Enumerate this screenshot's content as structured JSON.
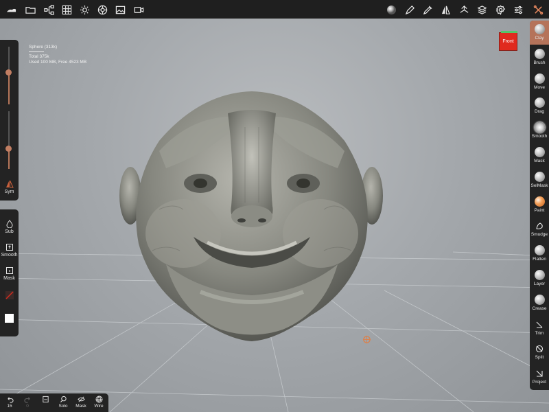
{
  "info": {
    "object": "Sphere (313k)",
    "total": "Total 375k",
    "memory": "Used 100 MB, Free 4523 MB"
  },
  "view_cube": {
    "label": "Front"
  },
  "left_panel": {
    "sym_label": "Sym",
    "tools": [
      {
        "icon": "drop-icon",
        "label": "Sub"
      },
      {
        "icon": "smooth-box-icon",
        "label": "Smooth"
      },
      {
        "icon": "mask-box-icon",
        "label": "Mask"
      }
    ],
    "radius_level": 0.55,
    "intensity_level": 0.35
  },
  "right_tools": [
    {
      "label": "Clay",
      "icon": "clay-ball-icon",
      "active": true
    },
    {
      "label": "Brush",
      "icon": "brush-ball-icon"
    },
    {
      "label": "Move",
      "icon": "move-ball-icon"
    },
    {
      "label": "Drag",
      "icon": "drag-ball-icon"
    },
    {
      "label": "Smooth",
      "icon": "smooth-ball-icon"
    },
    {
      "label": "Mask",
      "icon": "mask-ball-icon"
    },
    {
      "label": "SelMask",
      "icon": "selmask-ball-icon"
    },
    {
      "label": "Paint",
      "icon": "paint-ball-icon"
    },
    {
      "label": "Smudge",
      "icon": "smudge-icon"
    },
    {
      "label": "Flatten",
      "icon": "flatten-ball-icon"
    },
    {
      "label": "Layer",
      "icon": "layer-ball-icon"
    },
    {
      "label": "Crease",
      "icon": "crease-ball-icon"
    },
    {
      "label": "Trim",
      "icon": "trim-icon"
    },
    {
      "label": "Split",
      "icon": "split-icon"
    },
    {
      "label": "Project",
      "icon": "project-icon"
    }
  ],
  "bottom_bar": {
    "undo_count": "15",
    "redo_count": "0",
    "solo_label": "Solo",
    "mask_label": "Mask",
    "wire_label": "Wire"
  },
  "colors": {
    "accent": "#b5735a",
    "panel": "#232323",
    "topbar": "#1f1f1f",
    "front_cube": "#e02a1e"
  }
}
